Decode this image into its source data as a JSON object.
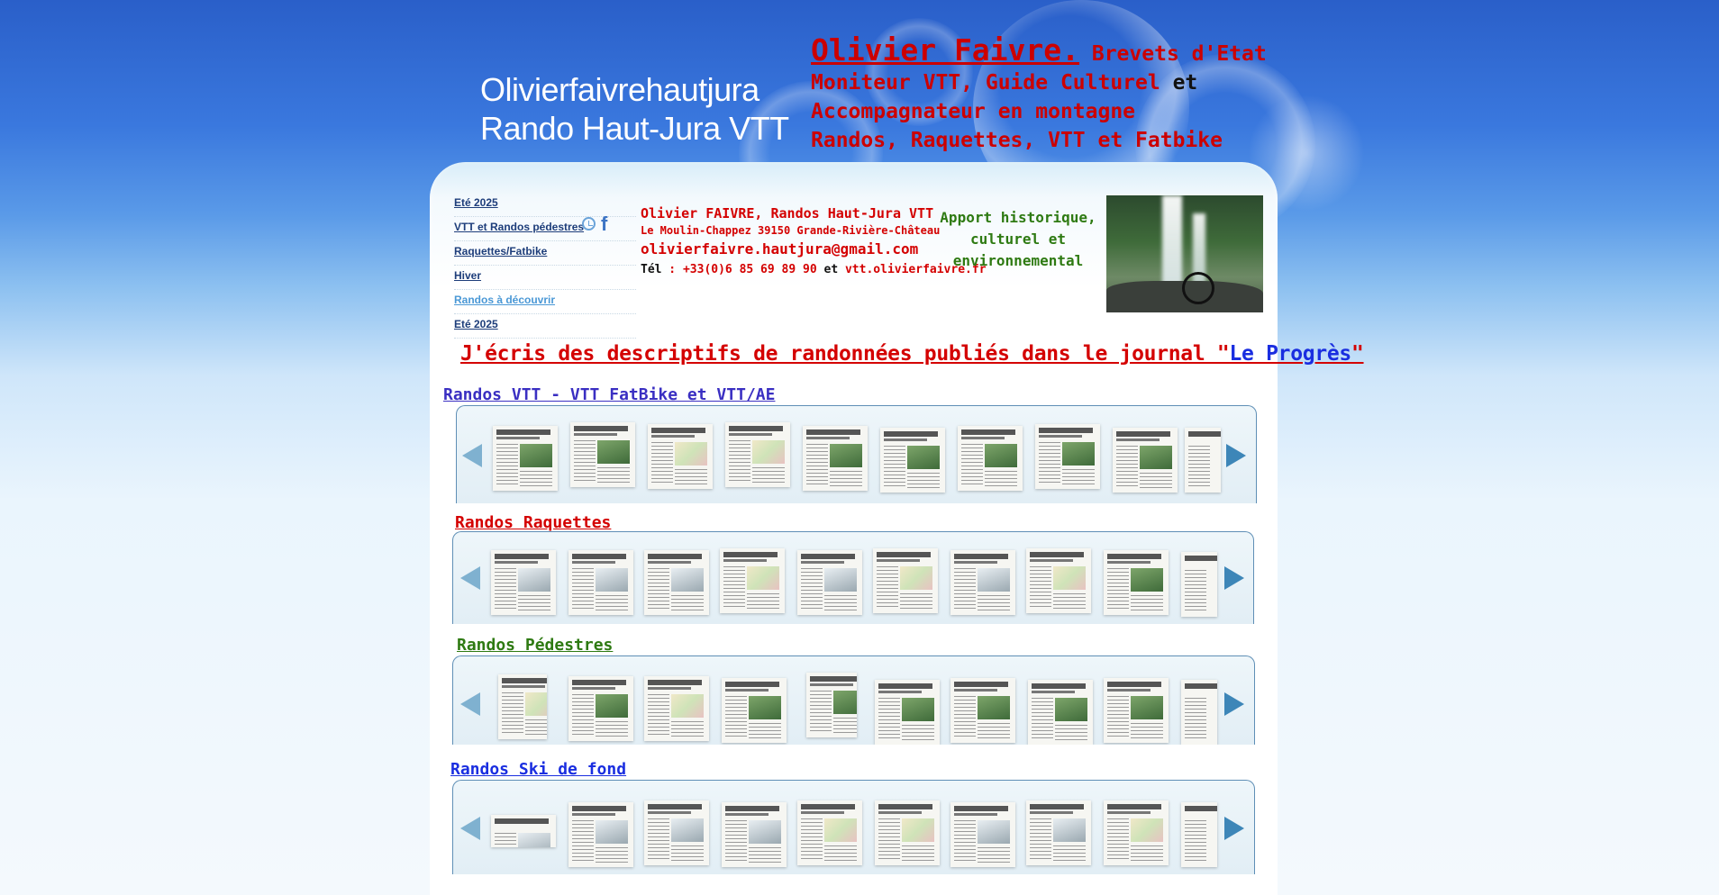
{
  "site": {
    "title_line1": "Olivierfaivrehautjura",
    "title_line2": "Rando Haut-Jura VTT"
  },
  "header": {
    "name": "Olivier Faivre.",
    "line1_rest": " Brevets d'Etat",
    "line2_red": "Moniteur VTT, Guide Culturel",
    "line2_black": " et",
    "line3": "Accompagnateur en montagne",
    "line4": "Randos, Raquettes, VTT et Fatbike"
  },
  "menu": {
    "items": [
      {
        "label": "Eté 2025"
      },
      {
        "label": "VTT et Randos pédestres"
      },
      {
        "label": "Raquettes/Fatbike"
      },
      {
        "label": "Hiver"
      },
      {
        "label": "Randos à découvrir"
      },
      {
        "label": "Eté 2025"
      }
    ]
  },
  "social": {
    "clock_icon": "clock-icon",
    "facebook_icon": "f"
  },
  "contact": {
    "line1": "Olivier FAIVRE, Randos Haut-Jura VTT",
    "line2": "Le Moulin-Chappez 39150 Grande-Rivière-Château",
    "email": "olivierfaivre.hautjura@gmail.com",
    "tel_label": "Tél",
    "tel_value": " : +33(0)6 85 69 89 90",
    "et": " et ",
    "website": "vtt.olivierfaivre.fr"
  },
  "apport": {
    "text": "Apport historique, culturel et environnemental"
  },
  "journal": {
    "prefix": "J'écris des descriptifs de randonnées publiés dans le journal \"",
    "name": "Le Progrès",
    "suffix": "\""
  },
  "sections": [
    {
      "title": "Randos VTT - VTT FatBike et VTT/AE",
      "color": "#3a2fc2"
    },
    {
      "title": "Randos Raquettes",
      "color": "#d40000"
    },
    {
      "title": "Randos Pédestres",
      "color": "#2e7a12"
    },
    {
      "title": "Randos Ski de fond",
      "color": "#1a2ee0"
    }
  ],
  "colors": {
    "accent_red": "#d40000",
    "journal_blue": "#1a2ee0",
    "apport_green": "#2e7a12"
  }
}
